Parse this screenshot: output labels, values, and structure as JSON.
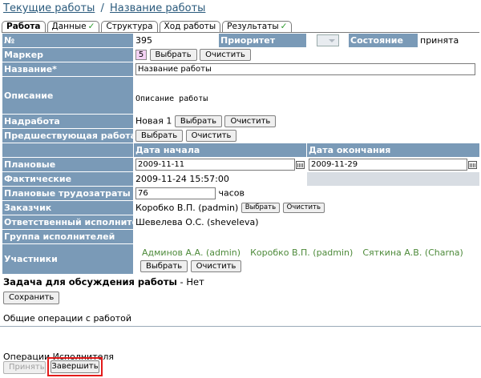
{
  "breadcrumb": {
    "parent": "Текущие работы",
    "separator": "/",
    "current": "Название работы"
  },
  "tabs": [
    {
      "label": "Работа",
      "active": true,
      "checked": false
    },
    {
      "label": "Данные",
      "active": false,
      "checked": true
    },
    {
      "label": "Структура",
      "active": false,
      "checked": false
    },
    {
      "label": "Ход работы",
      "active": false,
      "checked": false
    },
    {
      "label": "Результаты",
      "active": false,
      "checked": true
    }
  ],
  "check_glyph": "✓",
  "form": {
    "number_label": "№",
    "number_value": "395",
    "priority_label": "Приоритет",
    "state_label": "Состояние",
    "state_value": "принята",
    "marker_label": "Маркер",
    "marker_value": "5",
    "title_label": "Название*",
    "title_value": "Название работы",
    "description_label": "Описание",
    "description_value": "Описание работы",
    "parent_label": "Надработа",
    "parent_value": "Новая 1",
    "prev_label": "Предшествующая работа",
    "start_header": "Дата начала",
    "end_header": "Дата окончания",
    "planned_label": "Плановые",
    "planned_start": "2009-11-11",
    "planned_end": "2009-11-29",
    "actual_label": "Фактические",
    "actual_start": "2009-11-24 15:57:00",
    "effort_label": "Плановые трудозатраты",
    "effort_value": "76",
    "effort_unit": "часов",
    "customer_label": "Заказчик",
    "customer_value": "Коробко В.П. (padmin)",
    "responsible_label": "Ответственный исполнитель",
    "responsible_value": "Шевелева О.С. (sheveleva)",
    "group_label": "Группа исполнителей",
    "participants_label": "Участники",
    "participants": [
      "Админов А.А. (admin)",
      "Коробко В.П. (padmin)",
      "Сяткина А.В. (Charna)"
    ]
  },
  "buttons": {
    "select": "Выбрать",
    "clear": "Очистить",
    "save": "Сохранить",
    "accept": "Принять",
    "finish": "Завершить"
  },
  "discussion": {
    "label": "Задача для обсуждения работы",
    "value": "- Нет"
  },
  "general_ops": "Общие операции с работой",
  "executor_ops": "Операции Исполнителя"
}
